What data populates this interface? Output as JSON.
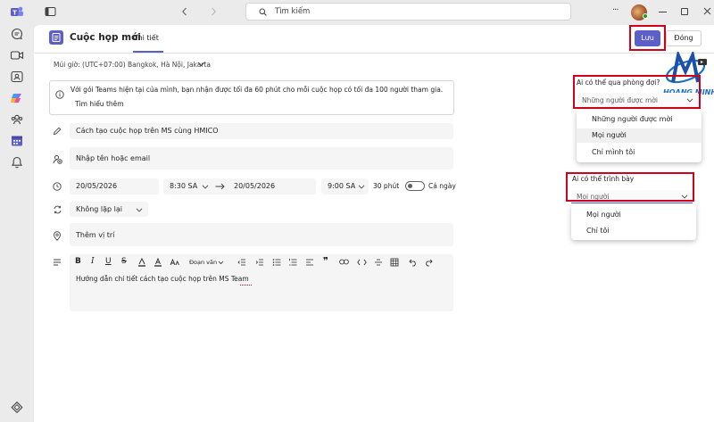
{
  "topbar": {
    "search_placeholder": "Tìm kiếm",
    "more": "···"
  },
  "header": {
    "title": "Cuộc họp mới",
    "tab_details": "Chi tiết",
    "save_label": "Lưu",
    "close_label": "Đóng"
  },
  "timezone": {
    "label": "Múi giờ: (UTC+07:00) Bangkok, Hà Nội, Jakarta"
  },
  "notice": {
    "text": "Với gói Teams hiện tại của mình, bạn nhận được tối đa 60 phút cho mỗi cuộc họp có tối đa 100 người tham gia.",
    "link": "Tìm hiểu thêm"
  },
  "form": {
    "title_value": "Cách tạo cuộc họp trên MS cùng HMICO",
    "attendees_placeholder": "Nhập tên hoặc email",
    "start_date": "20/05/2026",
    "start_time": "8:30 SA",
    "end_date": "20/05/2026",
    "end_time": "9:00 SA",
    "duration": "30 phút",
    "all_day": "Cả ngày",
    "repeat": "Không lặp lại",
    "location_placeholder": "Thêm vị trí",
    "paragraph_style": "Đoạn văn",
    "description": "Hướng dẫn chi tiết cách tạo cuộc họp trên MS Team"
  },
  "lobby": {
    "label": "Ai có thể qua phòng đợi?",
    "selected": "Những người được mời",
    "options": [
      "Những người được mời",
      "Mọi người",
      "Chỉ mình tôi"
    ]
  },
  "presenter": {
    "label": "Ai có thể trình bày",
    "selected": "Mọi người",
    "options": [
      "Mọi người",
      "Chỉ tôi"
    ]
  },
  "watermark": {
    "text": "HOANG MINH"
  },
  "colors": {
    "accent": "#5b5fc7",
    "highlight": "#d0021b",
    "panel": "#ffffff",
    "field": "#f5f5f5"
  }
}
